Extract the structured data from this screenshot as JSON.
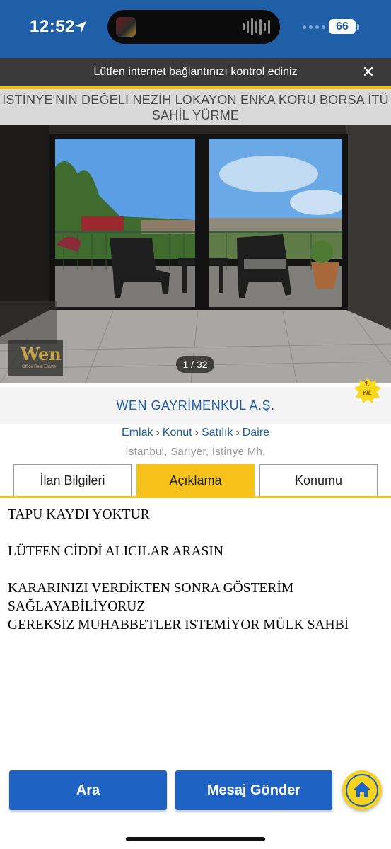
{
  "status_bar": {
    "time": "12:52",
    "battery": "66"
  },
  "connection_banner": {
    "message": "Lütfen internet bağlantınızı kontrol ediniz",
    "close_glyph": "✕"
  },
  "listing": {
    "title": "İSTİNYE'NİN DEĞELİ NEZİH LOKAYON ENKA KORU BORSA İTÜ SAHİL YÜRME",
    "photo_counter": "1 / 32",
    "watermark_logo": "Wen",
    "watermark_sub": "Office Real Estate",
    "agency_name": "WEN GAYRİMENKUL A.Ş.",
    "year_badge": {
      "line1": "1.",
      "line2": "YIL"
    },
    "breadcrumb": [
      "Emlak",
      "Konut",
      "Satılık",
      "Daire"
    ],
    "breadcrumb_separator": "›",
    "location": "İstanbul, Sarıyer, İstinye Mh."
  },
  "tabs": [
    {
      "label": "İlan Bilgileri",
      "active": false
    },
    {
      "label": "Açıklama",
      "active": true
    },
    {
      "label": "Konumu",
      "active": false
    }
  ],
  "description": {
    "line1": "TAPU KAYDI YOKTUR",
    "line2": "LÜTFEN CİDDİ ALICILAR ARASIN",
    "line3": "KARARINIZI VERDİKTEN SONRA GÖSTERİM SAĞLAYABİLİYORUZ",
    "line4": "GEREKSİZ MUHABBETLER İSTEMİYOR MÜLK SAHBİ"
  },
  "actions": {
    "call_label": "Ara",
    "message_label": "Mesaj Gönder",
    "home_icon": "home-icon"
  },
  "colors": {
    "primary_blue": "#1f5fa8",
    "button_blue": "#1e63c3",
    "accent_yellow": "#f7c31a"
  }
}
